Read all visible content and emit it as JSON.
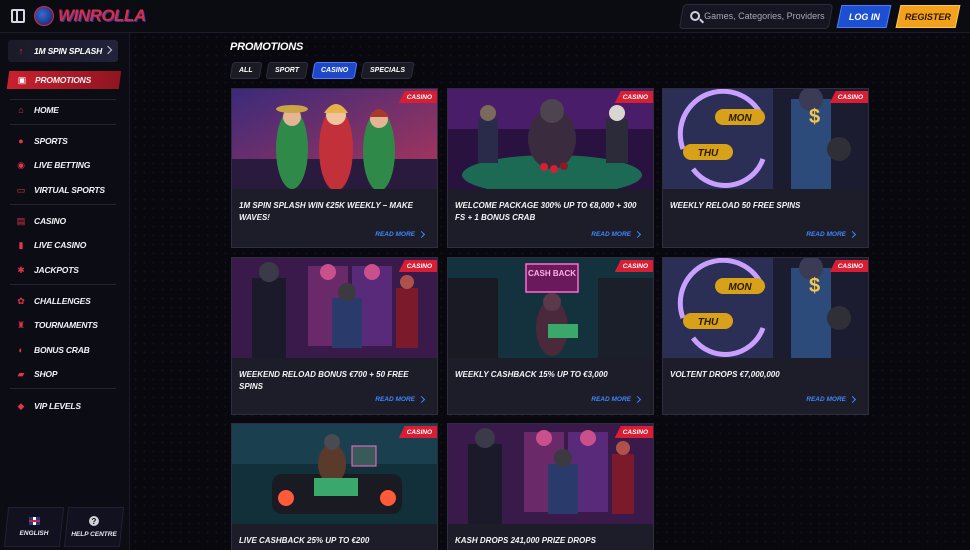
{
  "header": {
    "logo_text": "WINROLLA",
    "search_placeholder": "Games, Categories, Providers",
    "login_label": "LOG IN",
    "register_label": "REGISTER"
  },
  "sidebar": {
    "top_item": "1M SPIN SPLASH",
    "active_item": "PROMOTIONS",
    "items": [
      {
        "label": "HOME",
        "icon": "home-icon"
      },
      {
        "label": "SPORTS",
        "icon": "ball-icon"
      },
      {
        "label": "LIVE BETTING",
        "icon": "live-icon"
      },
      {
        "label": "VIRTUAL SPORTS",
        "icon": "virtual-icon"
      },
      {
        "label": "CASINO",
        "icon": "slot-icon"
      },
      {
        "label": "LIVE CASINO",
        "icon": "cards-icon"
      },
      {
        "label": "JACKPOTS",
        "icon": "jackpot-icon"
      },
      {
        "label": "CHALLENGES",
        "icon": "challenge-icon"
      },
      {
        "label": "TOURNAMENTS",
        "icon": "trophy-icon"
      },
      {
        "label": "BONUS CRAB",
        "icon": "crab-icon"
      },
      {
        "label": "SHOP",
        "icon": "bag-icon"
      },
      {
        "label": "VIP LEVELS",
        "icon": "diamond-icon"
      }
    ],
    "language_label": "ENGLISH",
    "help_label": "HELP CENTRE"
  },
  "main": {
    "title": "PROMOTIONS",
    "filters": [
      "ALL",
      "SPORT",
      "CASINO",
      "SPECIALS"
    ],
    "active_filter": "CASINO",
    "read_more_label": "READ MORE",
    "cards": [
      {
        "tag": "CASINO",
        "title": "1M SPIN SPLASH WIN €25K WEEKLY – MAKE WAVES!",
        "theme": "ladies"
      },
      {
        "tag": "CASINO",
        "title": "WELCOME PACKAGE 300% UP TO €8,000 + 300 FS + 1 BONUS CRAB",
        "theme": "poker"
      },
      {
        "tag": "CASINO",
        "title": "WEEKLY RELOAD 50 FREE SPINS",
        "theme": "reload",
        "badges": [
          "MON",
          "THU"
        ]
      },
      {
        "tag": "CASINO",
        "title": "WEEKEND RELOAD BONUS €700 + 50 FREE SPINS",
        "theme": "slots"
      },
      {
        "tag": "CASINO",
        "title": "WEEKLY CASHBACK 15% UP TO €3,000",
        "theme": "cashback",
        "sign": "CASH BACK"
      },
      {
        "tag": "CASINO",
        "title": "VOLTENT DROPS €7,000,000",
        "theme": "reload",
        "badges": [
          "MON",
          "THU"
        ]
      },
      {
        "tag": "CASINO",
        "title": "LIVE CASHBACK 25% UP TO €200",
        "theme": "car"
      },
      {
        "tag": "CASINO",
        "title": "KASH DROPS 241,000 PRIZE DROPS",
        "theme": "slots"
      }
    ]
  },
  "colors": {
    "accent_red": "#d81e34",
    "accent_blue": "#1e48c7",
    "read_more": "#3f86ff",
    "register": "#f2a21a"
  }
}
